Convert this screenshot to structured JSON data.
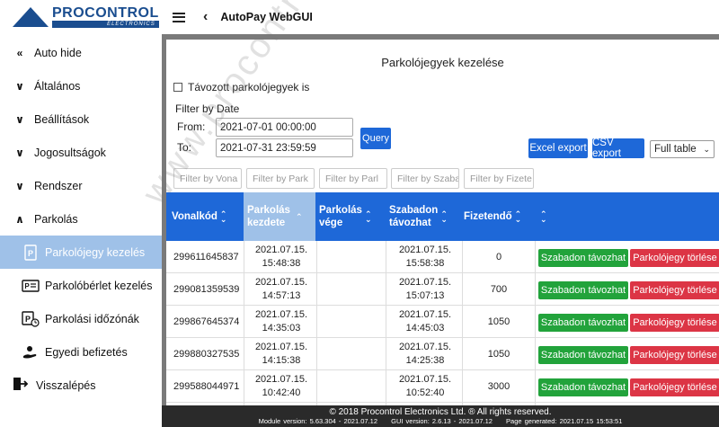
{
  "brand": {
    "name": "PROCONTROL",
    "tagline": "ELECTRONICS"
  },
  "topbar": {
    "title": "AutoPay WebGUI",
    "back_glyph": "‹"
  },
  "sidebar": {
    "auto_hide": "Auto hide",
    "items": [
      {
        "label": "Általános",
        "chev": "∨"
      },
      {
        "label": "Beállítások",
        "chev": "∨"
      },
      {
        "label": "Jogosultságok",
        "chev": "∨"
      },
      {
        "label": "Rendszer",
        "chev": "∨"
      },
      {
        "label": "Parkolás",
        "chev": "∧"
      }
    ],
    "subitems": [
      {
        "label": "Parkolójegy kezelés",
        "active": true
      },
      {
        "label": "Parkolóbérlet kezelés"
      },
      {
        "label": "Parkolási időzónák"
      },
      {
        "label": "Egyedi befizetés"
      }
    ],
    "logout": "Visszalépés"
  },
  "main": {
    "title": "Parkolójegyek kezelése",
    "checkbox_label": "Távozott parkolójegyek is",
    "filter_by_date": "Filter by Date",
    "from_label": "From:",
    "to_label": "To:",
    "from_value": "2021-07-01 00:00:00",
    "to_value": "2021-07-31 23:59:59",
    "query_label": "Query",
    "excel_export": "Excel export",
    "csv_export": "CSV export",
    "view_select": "Full table",
    "filters": [
      "Filter by Vona",
      "Filter by Park",
      "Filter by Parl",
      "Filter by Szaba",
      "Filter by Fizete"
    ]
  },
  "table": {
    "headers": {
      "col1": "Vonalkód",
      "col2a": "Parkolás",
      "col2b": "kezdete",
      "col3a": "Parkolás",
      "col3b": "vége",
      "col4a": "Szabadon",
      "col4b": "távozhat",
      "col5": "Fizetendő"
    },
    "rows": [
      {
        "code": "299611645837",
        "start_date": "2021.07.15.",
        "start_time": "15:48:38",
        "end": "",
        "free_date": "2021.07.15.",
        "free_time": "15:58:38",
        "due": "0"
      },
      {
        "code": "299081359539",
        "start_date": "2021.07.15.",
        "start_time": "14:57:13",
        "end": "",
        "free_date": "2021.07.15.",
        "free_time": "15:07:13",
        "due": "700"
      },
      {
        "code": "299867645374",
        "start_date": "2021.07.15.",
        "start_time": "14:35:03",
        "end": "",
        "free_date": "2021.07.15.",
        "free_time": "14:45:03",
        "due": "1050"
      },
      {
        "code": "299880327535",
        "start_date": "2021.07.15.",
        "start_time": "14:15:38",
        "end": "",
        "free_date": "2021.07.15.",
        "free_time": "14:25:38",
        "due": "1050"
      },
      {
        "code": "299588044971",
        "start_date": "2021.07.15.",
        "start_time": "10:42:40",
        "end": "",
        "free_date": "2021.07.15.",
        "free_time": "10:52:40",
        "due": "3000"
      }
    ],
    "free_btn": "Szabadon távozhat",
    "delete_btn": "Parkolójegy törlése"
  },
  "footer": {
    "copyright": "© 2018 Procontrol Electronics Ltd. ® All rights reserved.",
    "module_version": "Module version: 5.63.304 - 2021.07.12",
    "gui_version": "GUI version: 2.6.13 - 2021.07.12",
    "page_generated": "Page generated: 2021.07.15 15:53:51"
  },
  "watermark": "www.procontrol.hu",
  "colors": {
    "primary": "#1e68d8",
    "active": "#9fc1e8",
    "green": "#22a33b",
    "red": "#dc3545",
    "brand": "#1a4d8f"
  }
}
